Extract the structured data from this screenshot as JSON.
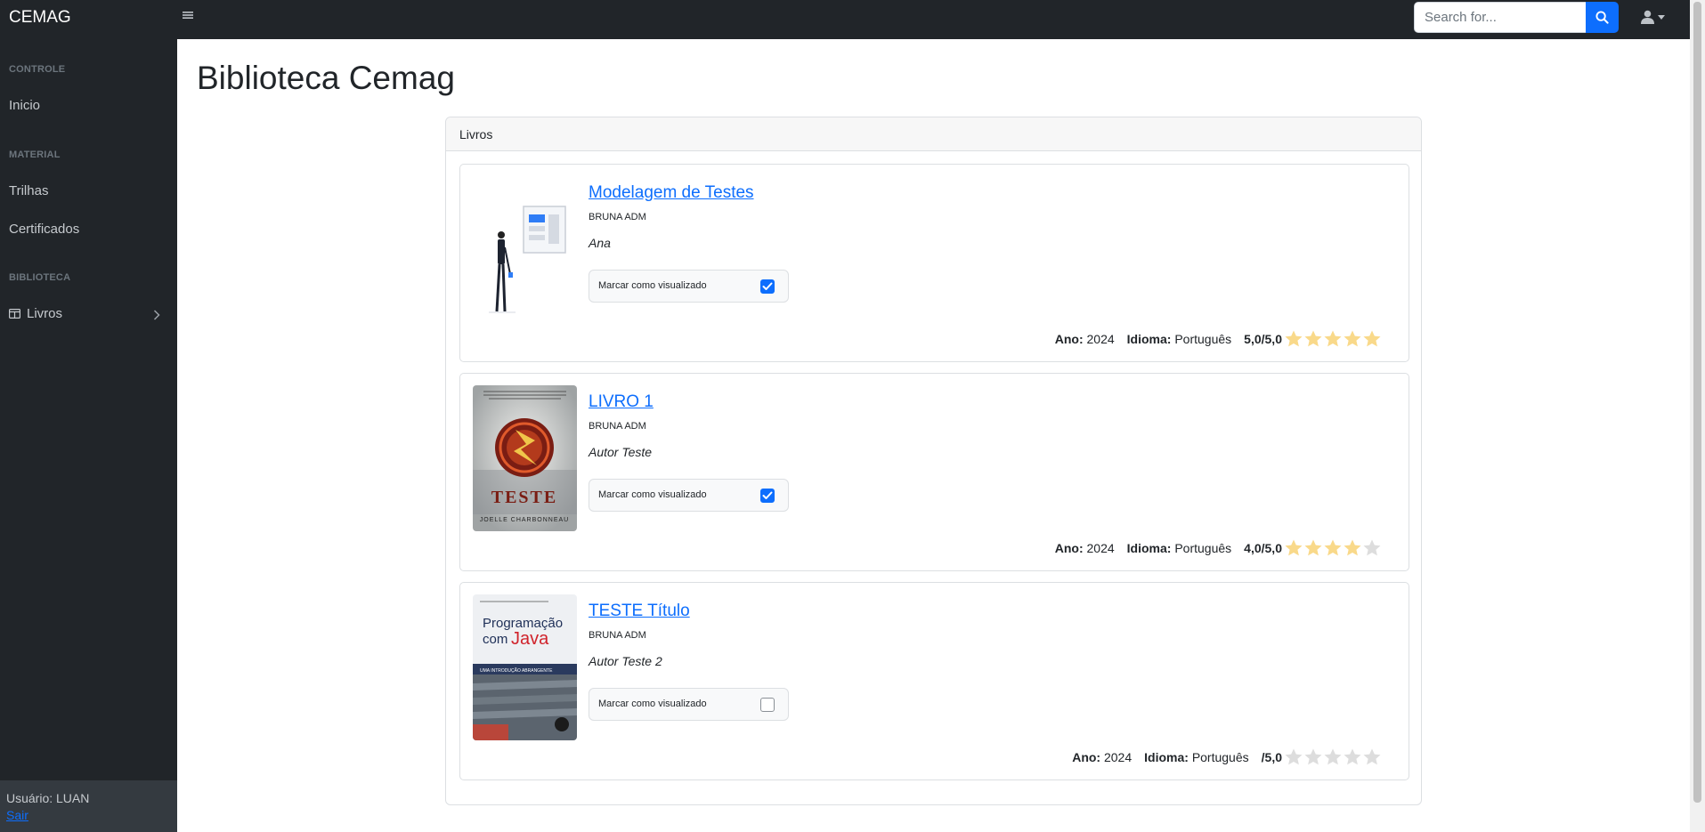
{
  "app": {
    "brand": "CEMAG"
  },
  "topnav": {
    "search_placeholder": "Search for..."
  },
  "sidebar": {
    "sections": [
      {
        "heading": "CONTROLE",
        "items": [
          {
            "label": "Inicio"
          }
        ]
      },
      {
        "heading": "MATERIAL",
        "items": [
          {
            "label": "Trilhas"
          },
          {
            "label": "Certificados"
          }
        ]
      },
      {
        "heading": "BIBLIOTECA",
        "items": [
          {
            "label": "Livros"
          }
        ]
      }
    ],
    "footer": {
      "user": "Usuário: LUAN",
      "logout": "Sair"
    }
  },
  "main": {
    "title": "Biblioteca Cemag",
    "card_header": "Livros",
    "books": [
      {
        "title": "Modelagem de Testes",
        "owner": "BRUNA ADM",
        "author": "Ana",
        "mark_label": "Marcar como visualizado",
        "viewed": true,
        "year_label": "Ano:",
        "year": "2024",
        "lang_label": "Idioma:",
        "language": "Português",
        "rating_text": "5,0/5,0",
        "rating": 5,
        "cover": "illustration-cover"
      },
      {
        "title": "LIVRO 1",
        "owner": "BRUNA ADM",
        "author": "Autor Teste",
        "mark_label": "Marcar como visualizado",
        "viewed": true,
        "year_label": "Ano:",
        "year": "2024",
        "lang_label": "Idioma:",
        "language": "Português",
        "rating_text": "4,0/5,0",
        "rating": 4,
        "cover": "teste-book-cover",
        "cover_text": {
          "title": "TESTE",
          "author": "JOELLE CHARBONNEAU"
        }
      },
      {
        "title": "TESTE Título",
        "owner": "BRUNA ADM",
        "author": "Autor Teste 2",
        "mark_label": "Marcar como visualizado",
        "viewed": false,
        "year_label": "Ano:",
        "year": "2024",
        "lang_label": "Idioma:",
        "language": "Português",
        "rating_text": "/5,0",
        "rating": 0,
        "cover": "java-book-cover",
        "cover_text": {
          "line1": "Programação",
          "line2": "com",
          "line3": "Java",
          "band": "UMA INTRODUÇÃO ABRANGENTE"
        }
      }
    ]
  },
  "colors": {
    "star_on": "#f9d98a",
    "star_off": "#dddddd",
    "link": "#0d6efd",
    "dark": "#212529"
  }
}
